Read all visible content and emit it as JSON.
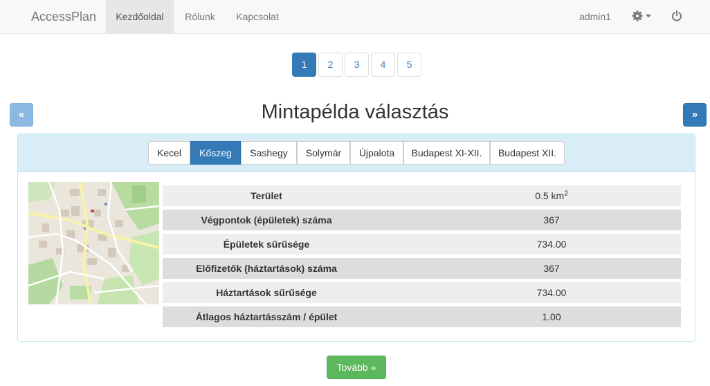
{
  "navbar": {
    "brand": "AccessPlan",
    "links": [
      {
        "label": "Kezdőoldal",
        "active": true
      },
      {
        "label": "Rólunk",
        "active": false
      },
      {
        "label": "Kapcsolat",
        "active": false
      }
    ],
    "user": "admin1",
    "icons": {
      "settings": "gear-icon",
      "dropdown": "caret-down-icon",
      "logout": "power-icon"
    }
  },
  "pagination": {
    "pages": [
      "1",
      "2",
      "3",
      "4",
      "5"
    ],
    "active_page": "1"
  },
  "title": "Mintapélda választás",
  "arrows": {
    "prev": "«",
    "next": "»"
  },
  "tabs": [
    {
      "label": "Kecel",
      "active": false
    },
    {
      "label": "Kőszeg",
      "active": true
    },
    {
      "label": "Sashegy",
      "active": false
    },
    {
      "label": "Solymár",
      "active": false
    },
    {
      "label": "Újpalota",
      "active": false
    },
    {
      "label": "Budapest XI-XII.",
      "active": false
    },
    {
      "label": "Budapest XII.",
      "active": false
    }
  ],
  "stats": [
    {
      "label": "Terület",
      "value": "0.5 km",
      "sup": "2"
    },
    {
      "label": "Végpontok (épületek) száma",
      "value": "367"
    },
    {
      "label": "Épületek sűrűsége",
      "value": "734.00"
    },
    {
      "label": "Előfizetők (háztartások) száma",
      "value": "367"
    },
    {
      "label": "Háztartások sűrűsége",
      "value": "734.00"
    },
    {
      "label": "Átlagos háztartásszám / épület",
      "value": "1.00"
    }
  ],
  "next_button": "Tovább »",
  "colors": {
    "primary": "#337ab7",
    "success": "#5cb85c",
    "info_bg": "#d9edf7",
    "info_border": "#bce8f1"
  }
}
